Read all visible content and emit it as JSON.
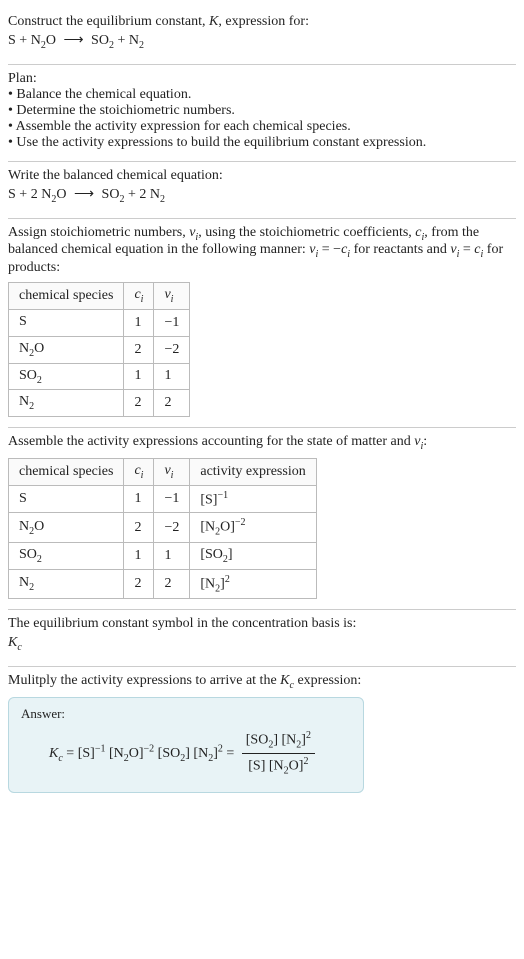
{
  "intro": {
    "title_a": "Construct the equilibrium constant, ",
    "title_b": ", expression for:",
    "K": "K"
  },
  "eq_unbalanced": {
    "S": "S",
    "plus": " + ",
    "N2O": "N",
    "N2O_sub": "2",
    "N2O_tail": "O",
    "arrow": "⟶",
    "SO2": "SO",
    "SO2_sub": "2",
    "N2": "N",
    "N2_sub": "2"
  },
  "plan": {
    "heading": "Plan:",
    "b1": "• Balance the chemical equation.",
    "b2": "• Determine the stoichiometric numbers.",
    "b3": "• Assemble the activity expression for each chemical species.",
    "b4": "• Use the activity expressions to build the equilibrium constant expression."
  },
  "balanced": {
    "heading": "Write the balanced chemical equation:",
    "two": "2 "
  },
  "stoich": {
    "text_a": "Assign stoichiometric numbers, ",
    "nu_i": "ν",
    "nu_sub": "i",
    "text_b": ", using the stoichiometric coefficients, ",
    "c_i": "c",
    "c_sub": "i",
    "text_c": ", from the balanced chemical equation in the following manner: ",
    "eq1_a": "ν",
    "eq1_b": " = −",
    "eq1_c": "c",
    "text_d": " for reactants and ",
    "eq2_a": "ν",
    "eq2_b": " = ",
    "eq2_c": "c",
    "text_e": " for products:"
  },
  "table1": {
    "h1": "chemical species",
    "h2": "c",
    "h2_sub": "i",
    "h3": "ν",
    "h3_sub": "i",
    "rows": [
      {
        "sp_a": "S",
        "sp_b": "",
        "sp_c": "",
        "c": "1",
        "nu": "−1"
      },
      {
        "sp_a": "N",
        "sp_b": "2",
        "sp_c": "O",
        "c": "2",
        "nu": "−2"
      },
      {
        "sp_a": "SO",
        "sp_b": "2",
        "sp_c": "",
        "c": "1",
        "nu": "1"
      },
      {
        "sp_a": "N",
        "sp_b": "2",
        "sp_c": "",
        "c": "2",
        "nu": "2"
      }
    ]
  },
  "activity": {
    "text_a": "Assemble the activity expressions accounting for the state of matter and ",
    "text_b": ":"
  },
  "table2": {
    "h1": "chemical species",
    "h2": "c",
    "h2_sub": "i",
    "h3": "ν",
    "h3_sub": "i",
    "h4": "activity expression",
    "rows": [
      {
        "sp_a": "S",
        "sp_b": "",
        "sp_c": "",
        "c": "1",
        "nu": "−1",
        "act_a": "[S]",
        "act_sup": "−1"
      },
      {
        "sp_a": "N",
        "sp_b": "2",
        "sp_c": "O",
        "c": "2",
        "nu": "−2",
        "act_a": "[N",
        "act_sub": "2",
        "act_b": "O]",
        "act_sup": "−2"
      },
      {
        "sp_a": "SO",
        "sp_b": "2",
        "sp_c": "",
        "c": "1",
        "nu": "1",
        "act_a": "[SO",
        "act_sub": "2",
        "act_b": "]",
        "act_sup": ""
      },
      {
        "sp_a": "N",
        "sp_b": "2",
        "sp_c": "",
        "c": "2",
        "nu": "2",
        "act_a": "[N",
        "act_sub": "2",
        "act_b": "]",
        "act_sup": "2"
      }
    ]
  },
  "kc_symbol": {
    "text": "The equilibrium constant symbol in the concentration basis is:",
    "K": "K",
    "c": "c"
  },
  "final": {
    "text_a": "Mulitply the activity expressions to arrive at the ",
    "K": "K",
    "Ksub": "c",
    "text_b": " expression:",
    "answer_label": "Answer:",
    "eq": " = ",
    "S_inv": "[S]",
    "S_sup": "−1",
    "N2O": "[N",
    "N2O_sub": "2",
    "N2O_b": "O]",
    "N2O_sup": "−2",
    "SO2": "[SO",
    "SO2_sub": "2",
    "SO2_b": "]",
    "N2": "[N",
    "N2_sub": "2",
    "N2_b": "]",
    "N2_sup": "2",
    "frac_eq": " = ",
    "num_SO2": "[SO",
    "num_SO2_sub": "2",
    "num_SO2_b": "] ",
    "num_N2": "[N",
    "num_N2_sub": "2",
    "num_N2_b": "]",
    "num_N2_sup": "2",
    "den_S": "[S] ",
    "den_N2O": "[N",
    "den_N2O_sub": "2",
    "den_N2O_b": "O]",
    "den_N2O_sup": "2"
  }
}
